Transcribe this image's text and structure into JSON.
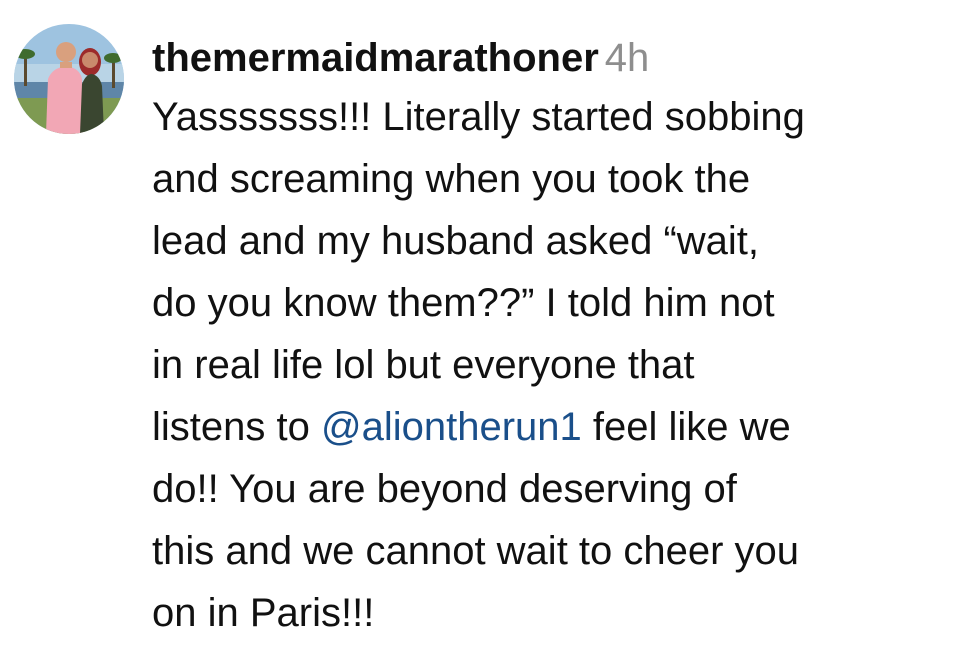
{
  "comment": {
    "username": "themermaidmarathoner",
    "timestamp": "4h",
    "avatar_icon": "profile-photo-couple",
    "lines": [
      "Yasssssss!!! Literally started sobbing",
      "and screaming when you took the",
      "lead and my husband asked “wait,",
      "do you know them??” I told him not",
      "in real life lol but everyone that"
    ],
    "line6_before": "listens to ",
    "mention": "@aliontherun1",
    "line6_after": " feel like we",
    "lines_after": [
      "do!! You are beyond deserving of",
      "this and we cannot wait to cheer you",
      "on in Paris!!!"
    ]
  },
  "colors": {
    "text": "#111111",
    "timestamp": "#8e8e8e",
    "mention": "#1a4f8a",
    "background": "#ffffff"
  }
}
